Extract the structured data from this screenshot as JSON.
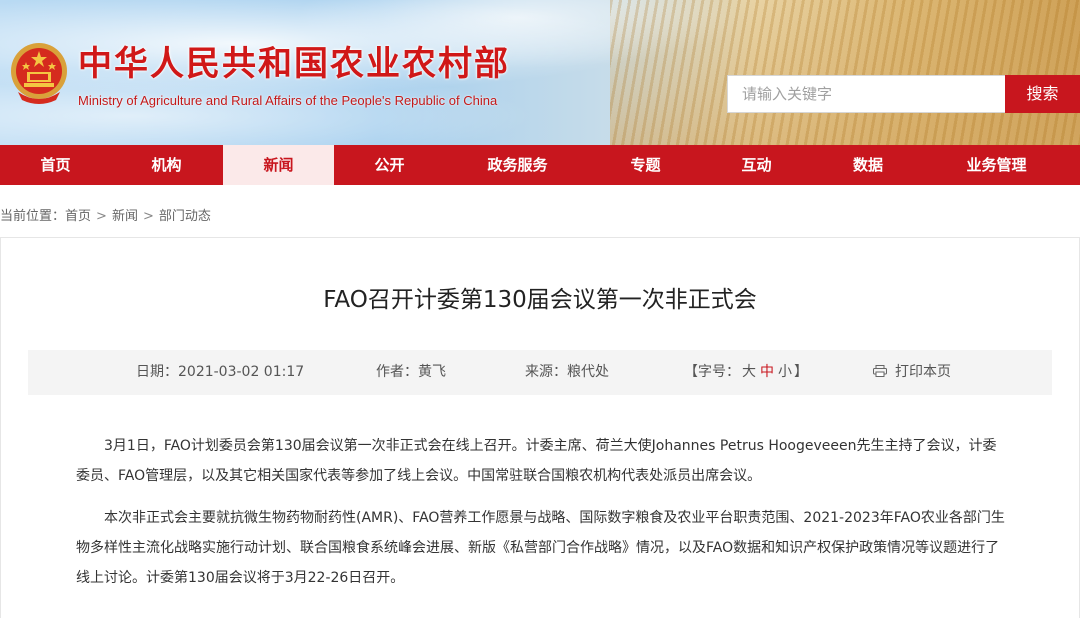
{
  "header": {
    "site_title": "中华人民共和国农业农村部",
    "site_subtitle": "Ministry of Agriculture and Rural Affairs of the People's Republic of China",
    "emblem_icon": "national-emblem-icon",
    "search": {
      "placeholder": "请输入关键字",
      "button_label": "搜索"
    }
  },
  "nav": {
    "items": [
      {
        "label": "首页"
      },
      {
        "label": "机构"
      },
      {
        "label": "新闻",
        "active": true
      },
      {
        "label": "公开"
      },
      {
        "label": "政务服务"
      },
      {
        "label": "专题"
      },
      {
        "label": "互动"
      },
      {
        "label": "数据"
      },
      {
        "label": "业务管理"
      }
    ]
  },
  "breadcrumb": {
    "prefix": "当前位置：",
    "items": [
      "首页",
      "新闻",
      "部门动态"
    ],
    "separator": ">"
  },
  "article": {
    "title": "FAO召开计委第130届会议第一次非正式会",
    "meta": {
      "date_label": "日期：",
      "date_value": "2021-03-02 01:17",
      "author_label": "作者：",
      "author_value": "黄飞",
      "source_label": "来源：",
      "source_value": "粮代处",
      "font_size_open": "【字号：",
      "font_size_large": "大",
      "font_size_medium": "中",
      "font_size_small": "小",
      "font_size_close": "】",
      "print_icon": "printer-icon",
      "print_label": "打印本页"
    },
    "paragraphs": [
      "3月1日，FAO计划委员会第130届会议第一次非正式会在线上召开。计委主席、荷兰大使Johannes Petrus Hoogeveeen先生主持了会议，计委委员、FAO管理层，以及其它相关国家代表等参加了线上会议。中国常驻联合国粮农机构代表处派员出席会议。",
      "本次非正式会主要就抗微生物药物耐药性(AMR)、FAO营养工作愿景与战略、国际数字粮食及农业平台职责范围、2021-2023年FAO农业各部门生物多样性主流化战略实施行动计划、联合国粮食系统峰会进展、新版《私营部门合作战略》情况，以及FAO数据和知识产权保护政策情况等议题进行了线上讨论。计委第130届会议将于3月22-26日召开。"
    ]
  },
  "colors": {
    "brand_red": "#c8161e",
    "nav_active_bg": "#fbe9e9",
    "meta_bg": "#f4f4f4"
  }
}
